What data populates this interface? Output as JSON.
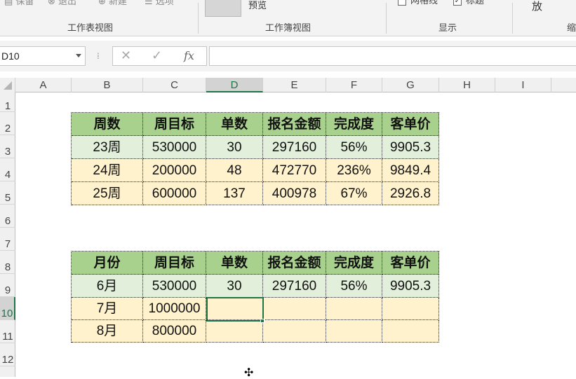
{
  "ribbon": {
    "view_buttons": [
      "保留",
      "退出",
      "新建",
      "选项"
    ],
    "group_worksheet_view": "工作表视图",
    "preview_label": "预览",
    "group_workbook_view": "工作簿视图",
    "gridlines_label": "网格线",
    "headings_label": "标题",
    "group_show": "显示",
    "zoom_label": "放",
    "group_zoom_partial": "缩"
  },
  "formula_bar": {
    "name_box": "D10",
    "cancel_icon": "✕",
    "enter_icon": "✓",
    "fx_label": "fx",
    "formula": ""
  },
  "columns": [
    "A",
    "B",
    "C",
    "D",
    "E",
    "F",
    "G",
    "H",
    "I"
  ],
  "rows": [
    "1",
    "2",
    "3",
    "4",
    "5",
    "6",
    "7",
    "8",
    "9",
    "10",
    "11",
    "12"
  ],
  "table1": {
    "headers": [
      "周数",
      "周目标",
      "单数",
      "报名金额",
      "完成度",
      "客单价"
    ],
    "rows": [
      [
        "23周",
        "530000",
        "30",
        "297160",
        "56%",
        "9905.3"
      ],
      [
        "24周",
        "200000",
        "48",
        "472770",
        "236%",
        "9849.4"
      ],
      [
        "25周",
        "600000",
        "137",
        "400978",
        "67%",
        "2926.8"
      ]
    ]
  },
  "table2": {
    "headers": [
      "月份",
      "周目标",
      "单数",
      "报名金额",
      "完成度",
      "客单价"
    ],
    "rows": [
      [
        "6月",
        "530000",
        "30",
        "297160",
        "56%",
        "9905.3"
      ],
      [
        "7月",
        "1000000",
        "",
        "",
        "",
        ""
      ],
      [
        "8月",
        "800000",
        "",
        "",
        "",
        ""
      ]
    ]
  }
}
